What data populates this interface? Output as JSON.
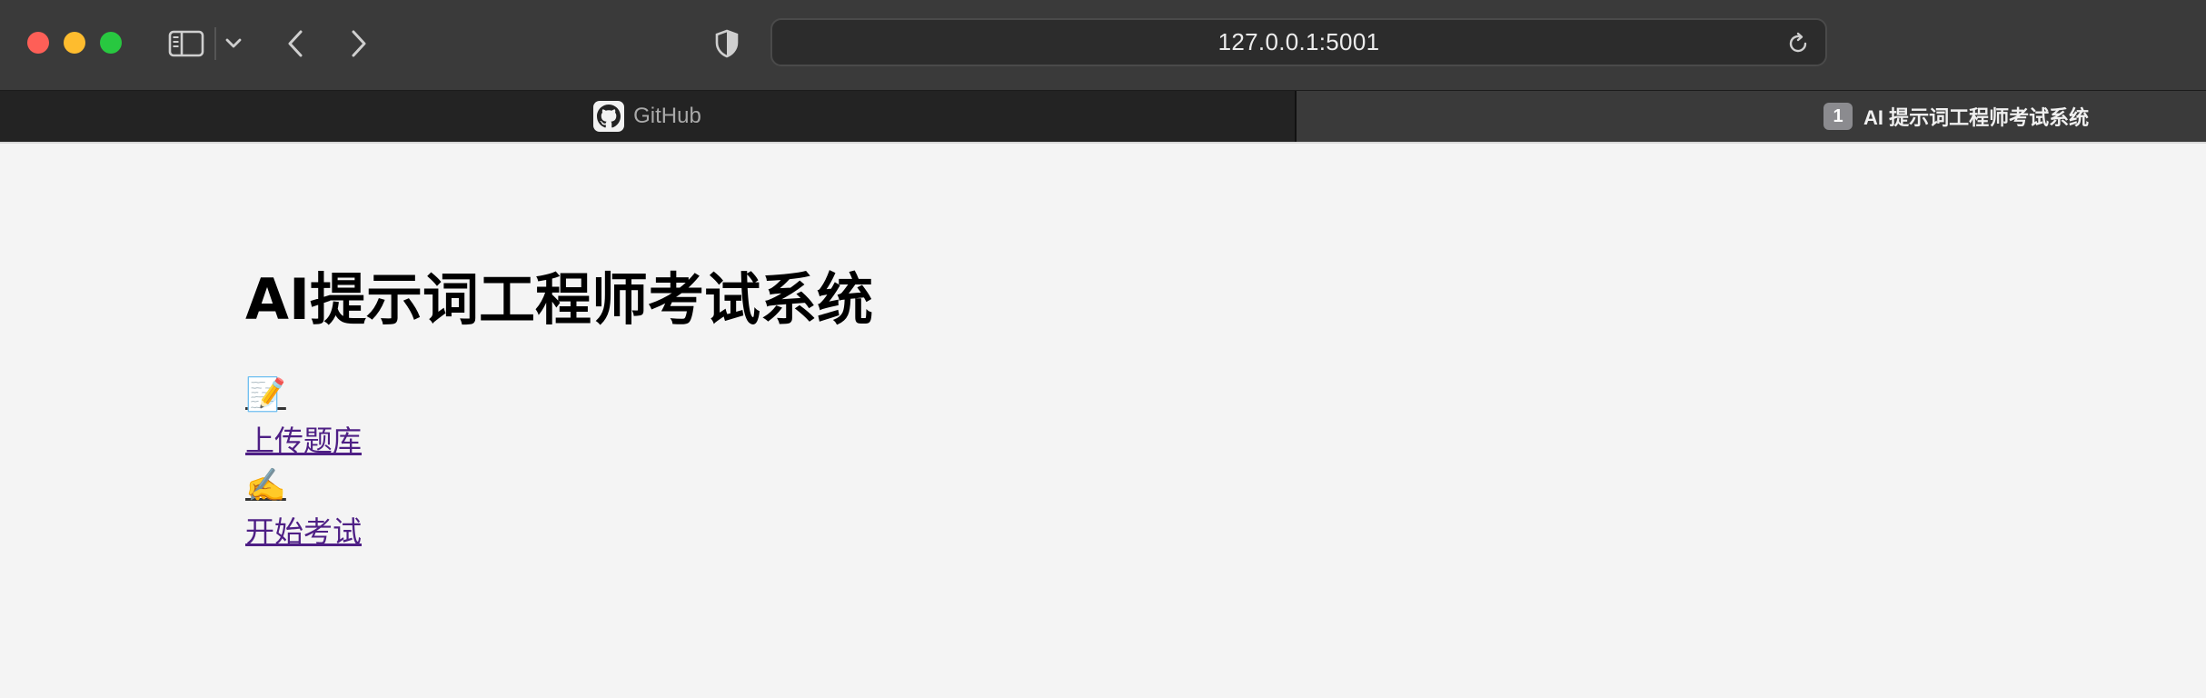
{
  "browser": {
    "url": "127.0.0.1:5001",
    "icons": {
      "sidebar": "sidebar-icon",
      "caret": "chevron-down-icon",
      "back": "chevron-left-icon",
      "forward": "chevron-right-icon",
      "privacy": "shield-icon",
      "reload": "reload-icon"
    },
    "colors": {
      "close": "#fe5f57",
      "minimize": "#febc2e",
      "maximize": "#28c840"
    }
  },
  "tabs": [
    {
      "label": "GitHub",
      "icon": "github-icon",
      "active": false
    },
    {
      "label": "AI 提示词工程师考试系统",
      "badge": "1",
      "active": true
    }
  ],
  "page": {
    "title": "AI提示词工程师考试系统",
    "links": [
      {
        "emoji": "📝",
        "label": "上传题库"
      },
      {
        "emoji": "✍️",
        "label": "开始考试"
      }
    ],
    "link_color": "#4e1f85"
  }
}
